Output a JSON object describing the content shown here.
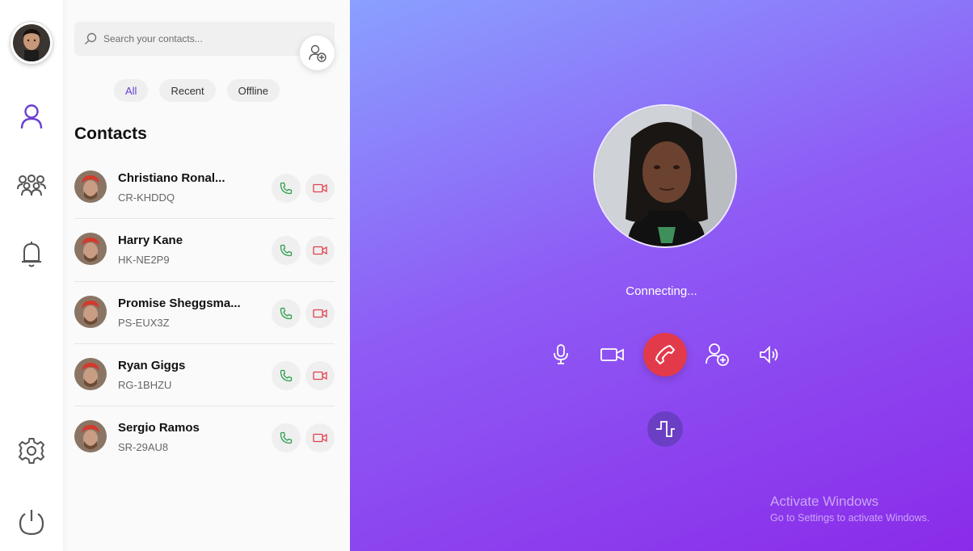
{
  "user": {
    "avatar": "user-avatar"
  },
  "rail": {
    "items": [
      {
        "icon": "person-icon",
        "name": "contacts"
      },
      {
        "icon": "group-icon",
        "name": "groups"
      },
      {
        "icon": "bell-icon",
        "name": "notifications"
      },
      {
        "icon": "gear-icon",
        "name": "settings"
      },
      {
        "icon": "power-icon",
        "name": "logout"
      }
    ],
    "accent": "#6a3fd1"
  },
  "search": {
    "placeholder": "Search your contacts..."
  },
  "filters": [
    "All",
    "Recent",
    "Offline"
  ],
  "active_filter": "All",
  "contacts_title": "Contacts",
  "contacts": [
    {
      "name": "Christiano Ronal...",
      "id": "CR-KHDDQ"
    },
    {
      "name": "Harry Kane",
      "id": "HK-NE2P9"
    },
    {
      "name": "Promise Sheggsma...",
      "id": "PS-EUX3Z"
    },
    {
      "name": "Ryan Giggs",
      "id": "RG-1BHZU"
    },
    {
      "name": "Sergio Ramos",
      "id": "SR-29AU8"
    }
  ],
  "call": {
    "status": "Connecting...",
    "controls": [
      "microphone-icon",
      "video-camera-icon",
      "end-call-icon",
      "add-person-icon",
      "speaker-icon",
      "flip-icon"
    ],
    "end_call_color": "#e23a4a",
    "call_icon_color": "#2e9e4f",
    "video_icon_color": "#e0404d"
  },
  "watermark": {
    "title": "Activate Windows",
    "subtitle": "Go to Settings to activate Windows."
  }
}
